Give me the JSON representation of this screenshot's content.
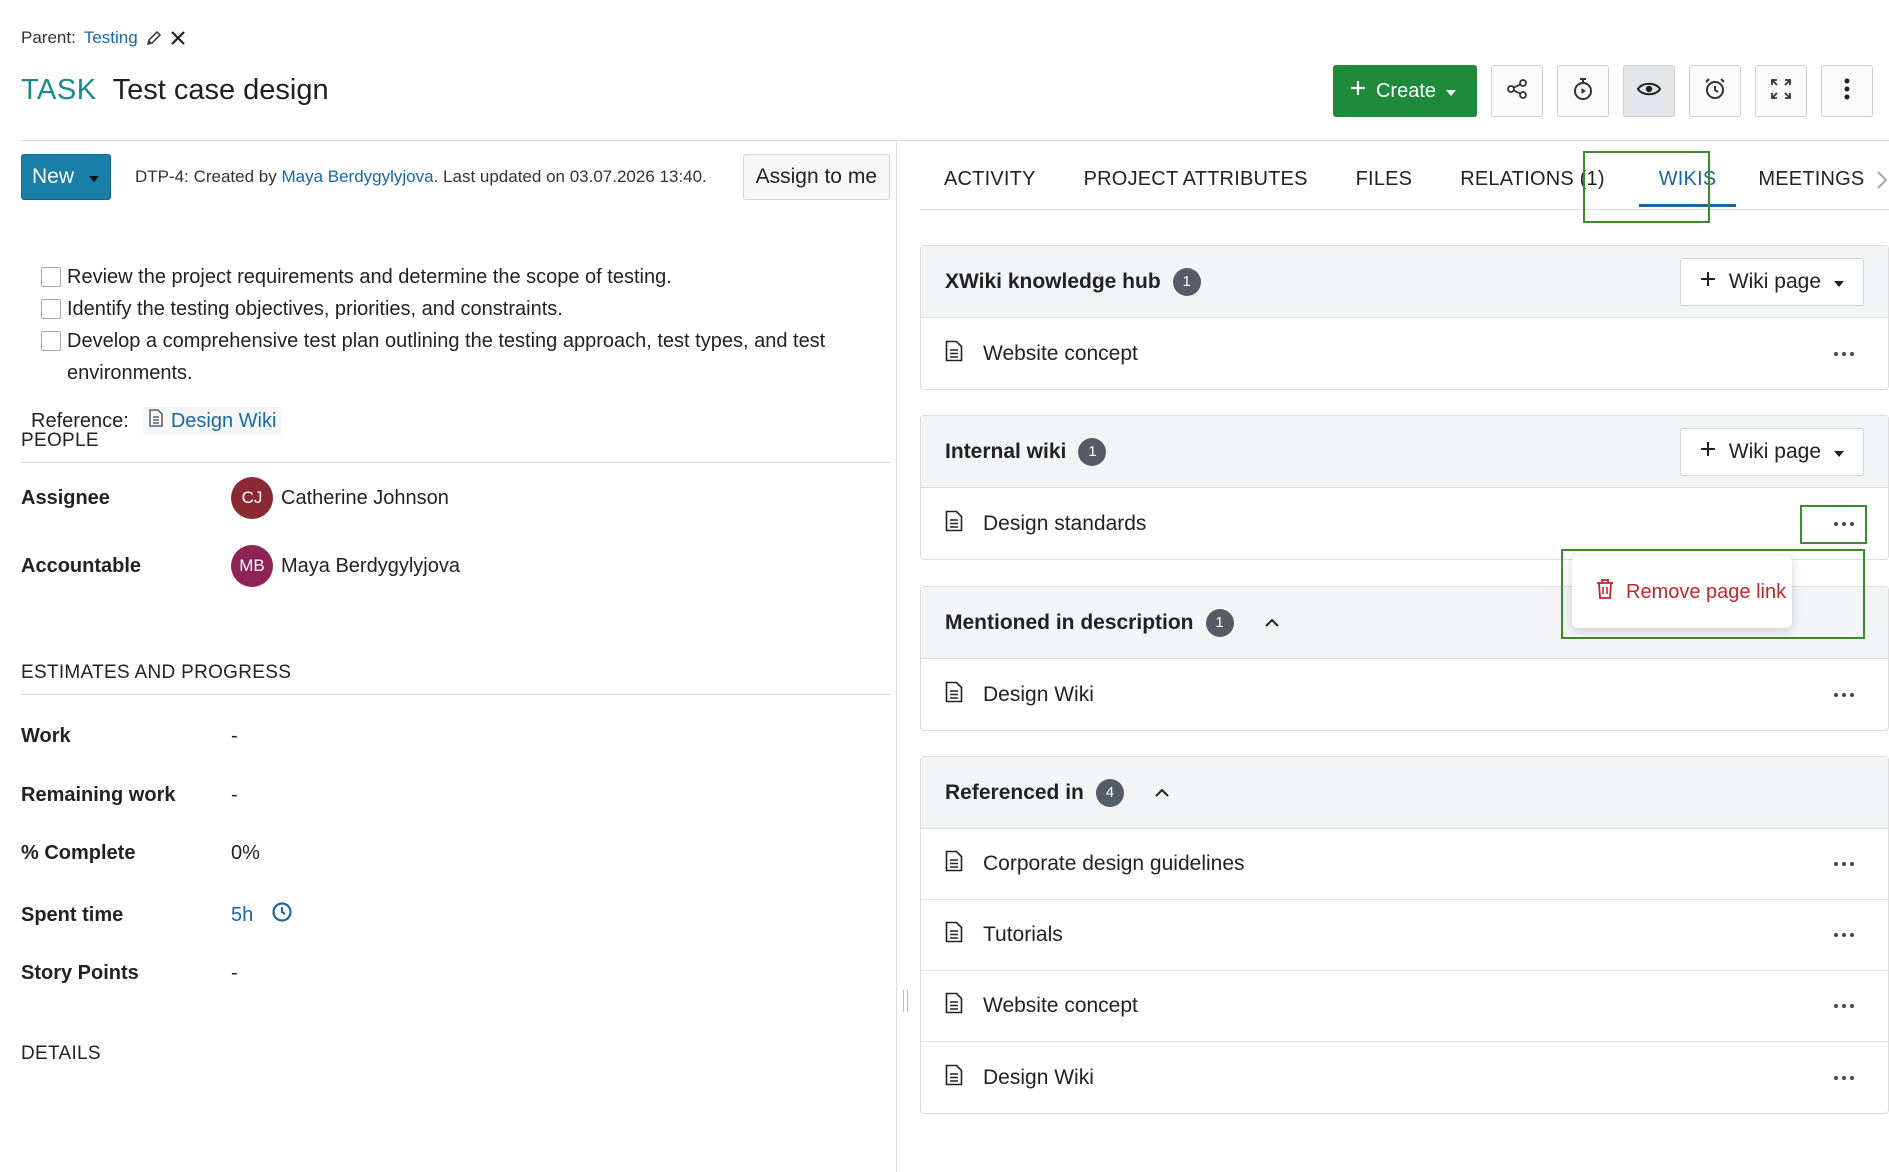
{
  "parent": {
    "label": "Parent:",
    "name": "Testing"
  },
  "task": {
    "type": "TASK",
    "subject": "Test case design"
  },
  "toolbar": {
    "create_label": "Create"
  },
  "status": {
    "label": "New",
    "meta_prefix": "DTP-4: Created by ",
    "meta_author": "Maya Berdygylyjova",
    "meta_suffix": ". Last updated on 03.07.2026 13:40.",
    "assign_label": "Assign to me"
  },
  "description": {
    "items": [
      "Review the project requirements and determine the scope of testing.",
      "Identify the testing objectives, priorities, and constraints.",
      "Develop a comprehensive test plan outlining the testing approach, test types, and test environments."
    ],
    "reference_label": "Reference:",
    "reference_link": "Design Wiki"
  },
  "people": {
    "heading": "PEOPLE",
    "assignee_label": "Assignee",
    "assignee_initials": "CJ",
    "assignee_name": "Catherine Johnson",
    "accountable_label": "Accountable",
    "accountable_initials": "MB",
    "accountable_name": "Maya Berdygylyjova"
  },
  "estimates": {
    "heading": "ESTIMATES AND PROGRESS",
    "work_label": "Work",
    "work_value": "-",
    "remaining_label": "Remaining work",
    "remaining_value": "-",
    "complete_label": "% Complete",
    "complete_value": "0%",
    "spent_label": "Spent time",
    "spent_value": "5h",
    "story_label": "Story Points",
    "story_value": "-"
  },
  "details": {
    "heading": "DETAILS"
  },
  "tabs": [
    "ACTIVITY",
    "PROJECT ATTRIBUTES",
    "FILES",
    "RELATIONS (1)",
    "WIKIS",
    "MEETINGS"
  ],
  "wikis": {
    "add_label": "Wiki page",
    "xwiki": {
      "title": "XWiki knowledge hub",
      "count": "1",
      "rows": [
        "Website concept"
      ]
    },
    "internal": {
      "title": "Internal wiki",
      "count": "1",
      "rows": [
        "Design standards"
      ]
    },
    "mentioned": {
      "title": "Mentioned in description",
      "count": "1",
      "rows": [
        "Design Wiki"
      ]
    },
    "referenced": {
      "title": "Referenced in",
      "count": "4",
      "rows": [
        "Corporate design guidelines",
        "Tutorials",
        "Website concept",
        "Design Wiki"
      ]
    }
  },
  "popup": {
    "remove_label": "Remove page link"
  },
  "colors": {
    "accent": "#1a67a3",
    "create_green": "#1f8a3c",
    "status_blue": "#1a7fa8",
    "highlight_green": "#3c8a2e",
    "danger": "#c0262d"
  },
  "icons": [
    "pencil-icon",
    "close-icon",
    "plus-icon",
    "caret-down-icon",
    "share-icon",
    "stopwatch-icon",
    "eye-icon",
    "alarm-icon",
    "fullscreen-icon",
    "kebab-icon",
    "document-icon",
    "clock-icon",
    "chevron-up-icon",
    "chevron-right-icon",
    "trash-icon"
  ]
}
